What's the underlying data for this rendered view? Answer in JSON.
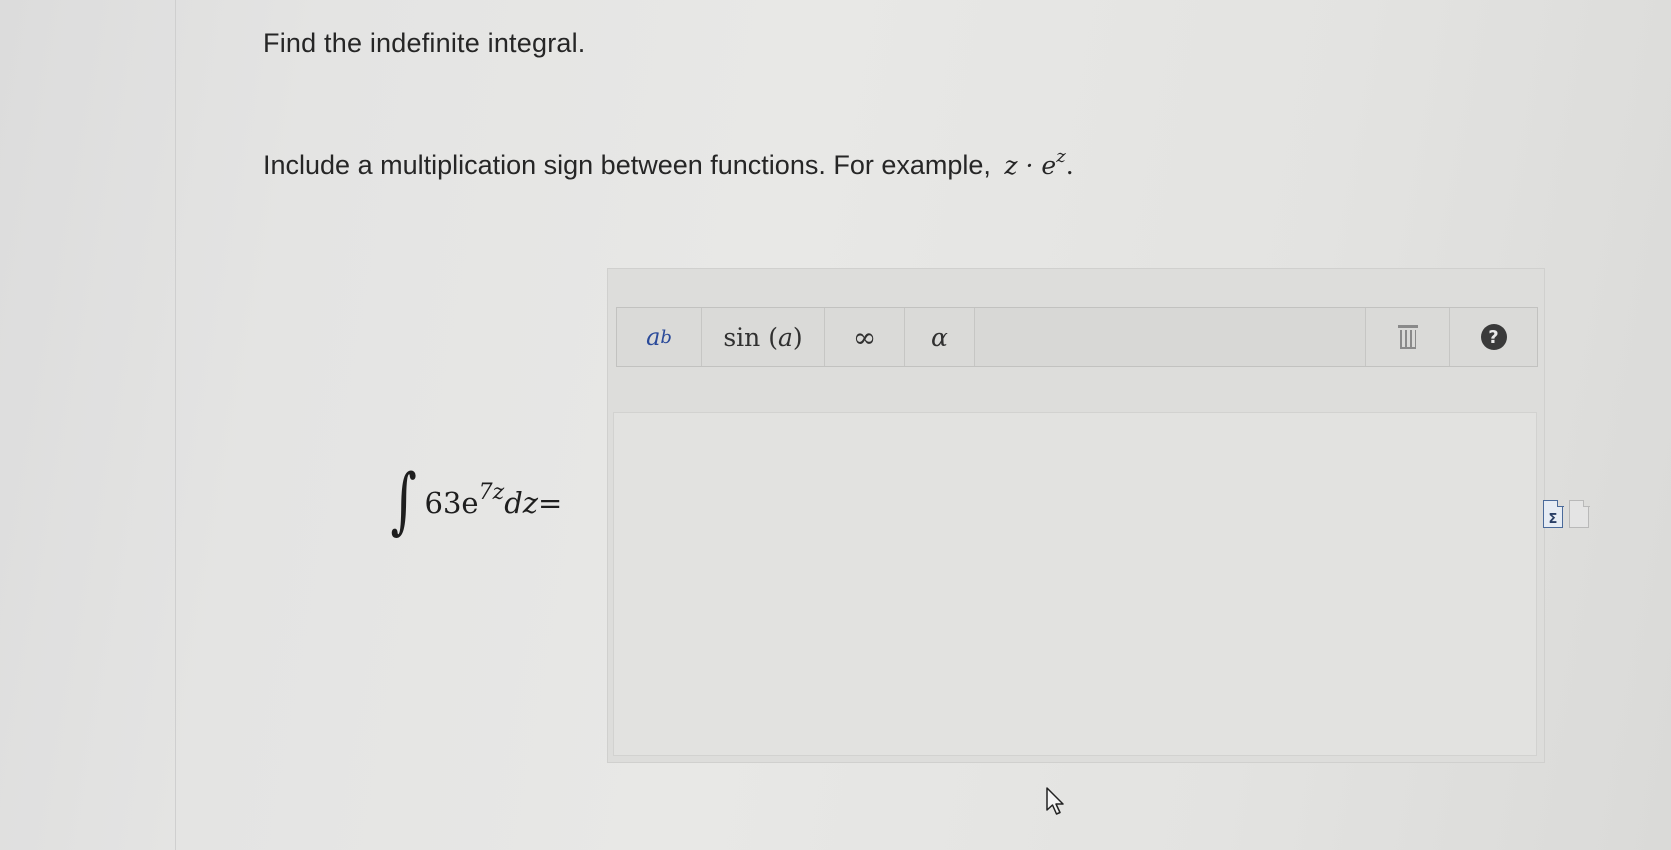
{
  "question": {
    "title": "Find the indefinite integral.",
    "instruction_text": "Include a multiplication sign between functions. For example,",
    "example_base": "z · e",
    "example_exponent": "z",
    "example_end": "."
  },
  "integral": {
    "sign": "∫",
    "coefficient": "63e",
    "exponent": "7z",
    "differential": "dz",
    "equals": "="
  },
  "toolbar": {
    "power_base": "a",
    "power_exponent": "b",
    "sin_prefix": "sin (",
    "sin_arg": "a",
    "sin_suffix": ")",
    "infinity": "∞",
    "alpha": "α",
    "help": "?"
  },
  "answer": {
    "value": ""
  },
  "side_icons": {
    "formula_icon_glyph": "Σ"
  },
  "icons": [
    "trash-icon",
    "help-icon",
    "formula-sheet-icon",
    "document-icon",
    "pointer-cursor-icon"
  ]
}
